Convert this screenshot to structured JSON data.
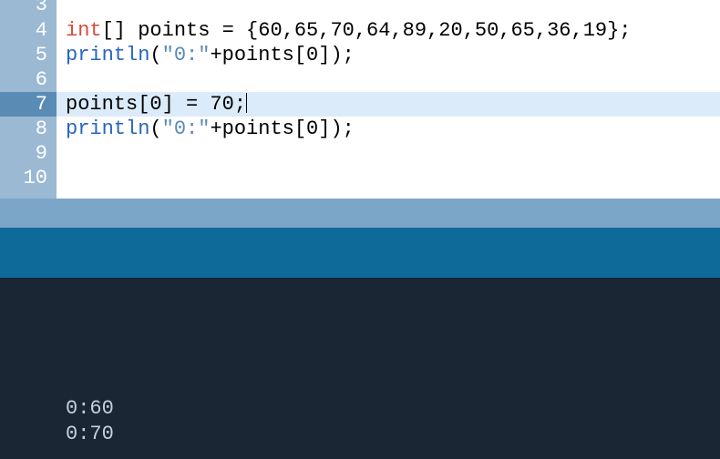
{
  "lines": [
    {
      "num": "3",
      "type": "partial"
    },
    {
      "num": "4",
      "tokens": [
        {
          "cls": "kw-type",
          "t": "int"
        },
        {
          "cls": "",
          "t": "[] points = {60,65,70,64,89,20,50,65,36,19};"
        }
      ]
    },
    {
      "num": "5",
      "tokens": [
        {
          "cls": "kw-func",
          "t": "println"
        },
        {
          "cls": "",
          "t": "("
        },
        {
          "cls": "str",
          "t": "\"0:\""
        },
        {
          "cls": "",
          "t": "+points[0]);"
        }
      ]
    },
    {
      "num": "6",
      "tokens": []
    },
    {
      "num": "7",
      "highlighted": true,
      "cursor": true,
      "tokens": [
        {
          "cls": "",
          "t": "points[0] = 70;"
        }
      ]
    },
    {
      "num": "8",
      "tokens": [
        {
          "cls": "kw-func",
          "t": "println"
        },
        {
          "cls": "",
          "t": "("
        },
        {
          "cls": "str",
          "t": "\"0:\""
        },
        {
          "cls": "",
          "t": "+points[0]);"
        }
      ]
    },
    {
      "num": "9",
      "tokens": []
    },
    {
      "num": "10",
      "tokens": []
    }
  ],
  "console": [
    "0:60",
    "0:70"
  ]
}
